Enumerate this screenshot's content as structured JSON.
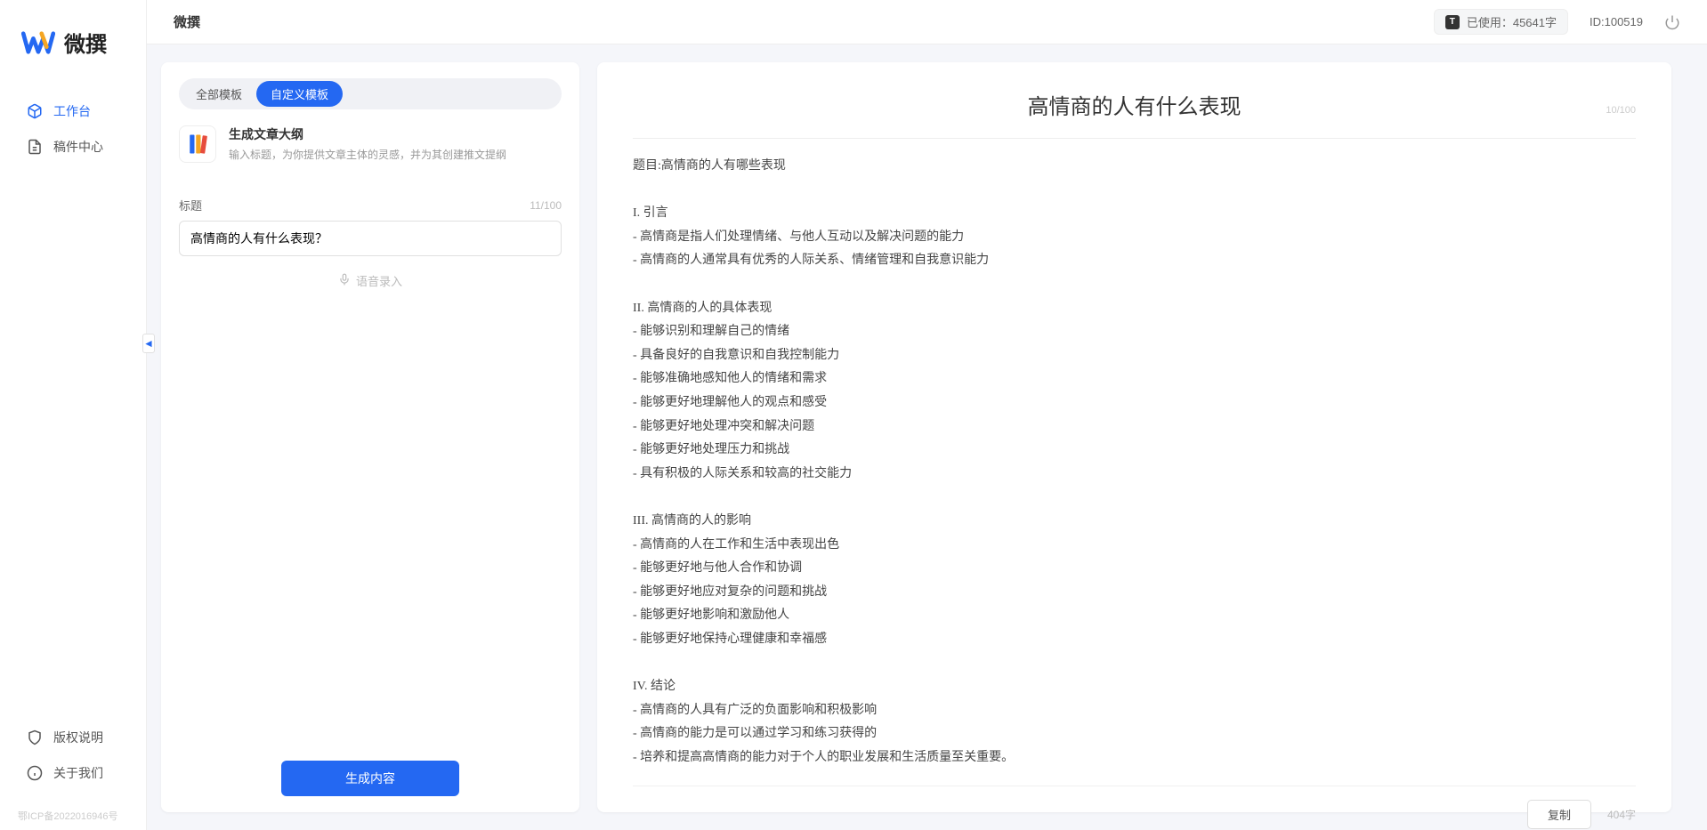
{
  "brand": {
    "name": "微撰"
  },
  "sidebar": {
    "nav": [
      {
        "label": "工作台",
        "active": true
      },
      {
        "label": "稿件中心",
        "active": false
      }
    ],
    "bottom": [
      {
        "label": "版权说明"
      },
      {
        "label": "关于我们"
      }
    ],
    "icp": "鄂ICP备2022016946号"
  },
  "topbar": {
    "title": "微撰",
    "usage_prefix": "已使用：",
    "usage_value": "45641字",
    "id_label": "ID:100519"
  },
  "leftPanel": {
    "tabs": [
      {
        "label": "全部模板",
        "active": false
      },
      {
        "label": "自定义模板",
        "active": true
      }
    ],
    "template": {
      "title": "生成文章大纲",
      "desc": "输入标题，为你提供文章主体的灵感，并为其创建推文提纲"
    },
    "form": {
      "title_label": "标题",
      "title_count": "11/100",
      "title_value": "高情商的人有什么表现？",
      "voice_label": "语音录入"
    },
    "generate_btn": "生成内容"
  },
  "output": {
    "title": "高情商的人有什么表现",
    "title_counter": "10/100",
    "body": "题目:高情商的人有哪些表现\n\nI. 引言\n- 高情商是指人们处理情绪、与他人互动以及解决问题的能力\n- 高情商的人通常具有优秀的人际关系、情绪管理和自我意识能力\n\nII. 高情商的人的具体表现\n- 能够识别和理解自己的情绪\n- 具备良好的自我意识和自我控制能力\n- 能够准确地感知他人的情绪和需求\n- 能够更好地理解他人的观点和感受\n- 能够更好地处理冲突和解决问题\n- 能够更好地处理压力和挑战\n- 具有积极的人际关系和较高的社交能力\n\nIII. 高情商的人的影响\n- 高情商的人在工作和生活中表现出色\n- 能够更好地与他人合作和协调\n- 能够更好地应对复杂的问题和挑战\n- 能够更好地影响和激励他人\n- 能够更好地保持心理健康和幸福感\n\nIV. 结论\n- 高情商的人具有广泛的负面影响和积极影响\n- 高情商的能力是可以通过学习和练习获得的\n- 培养和提高高情商的能力对于个人的职业发展和生活质量至关重要。",
    "copy_btn": "复制",
    "word_count": "404字"
  }
}
